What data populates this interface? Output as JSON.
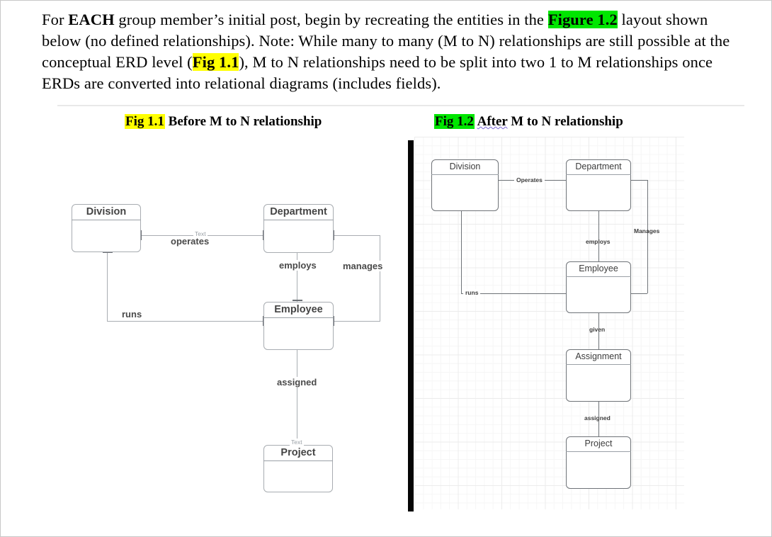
{
  "document": {
    "intro": {
      "seg1": "For ",
      "bold1": "EACH",
      "seg2": " group member’s initial post, begin by recreating the entities in the ",
      "hl_green1": "Figure 1.2",
      "seg3": " layout shown below (no defined relationships). Note:  While many to many (M to N) relationships are still possible at the conceptual ERD level (",
      "hl_yellow1": "Fig 1.1",
      "seg4": "), M to N relationships need to be split into two 1 to M relationships once ERDs are converted into relational diagrams (includes fields)."
    },
    "captions": {
      "left": {
        "tag": "Fig 1.1",
        "text": "Before M to N relationship"
      },
      "right": {
        "tag": "Fig 1.2",
        "underlined_word": "After",
        "text": " M to N relationship"
      }
    }
  },
  "figure_1_1": {
    "title": "Fig 1.1 Before M to N relationship",
    "entities": [
      {
        "name": "Division"
      },
      {
        "name": "Department"
      },
      {
        "name": "Employee"
      },
      {
        "name": "Project"
      }
    ],
    "relationships": [
      {
        "label": "operates",
        "from": "Division",
        "to": "Department"
      },
      {
        "label": "Text",
        "note": "default placeholder label above operates"
      },
      {
        "label": "employs",
        "from": "Department",
        "to": "Employee"
      },
      {
        "label": "manages",
        "from": "Department",
        "to": "Employee"
      },
      {
        "label": "runs",
        "from": "Division",
        "to": "Employee"
      },
      {
        "label": "assigned",
        "from": "Employee",
        "to": "Project"
      },
      {
        "label": "Text",
        "note": "default placeholder label above Project"
      }
    ]
  },
  "figure_1_2": {
    "title": "Fig 1.2 After M to N relationship",
    "entities": [
      {
        "name": "Division"
      },
      {
        "name": "Department"
      },
      {
        "name": "Employee"
      },
      {
        "name": "Assignment"
      },
      {
        "name": "Project"
      }
    ],
    "relationships": [
      {
        "label": "Operates",
        "from": "Division",
        "to": "Department"
      },
      {
        "label": "employs",
        "from": "Department",
        "to": "Employee"
      },
      {
        "label": "Manages",
        "from": "Department",
        "to": "Employee"
      },
      {
        "label": "runs",
        "from": "Division",
        "to": "Employee"
      },
      {
        "label": "given",
        "from": "Employee",
        "to": "Assignment"
      },
      {
        "label": "assigned",
        "from": "Assignment",
        "to": "Project"
      }
    ]
  },
  "colors": {
    "highlight_yellow": "#ffff00",
    "highlight_green": "#00e600",
    "entity_border_left": "#a8acb1",
    "entity_border_right": "#6f7378",
    "grid_minor": "#f6f6f6",
    "grid_major": "#ececec",
    "black_bar": "#050505"
  }
}
